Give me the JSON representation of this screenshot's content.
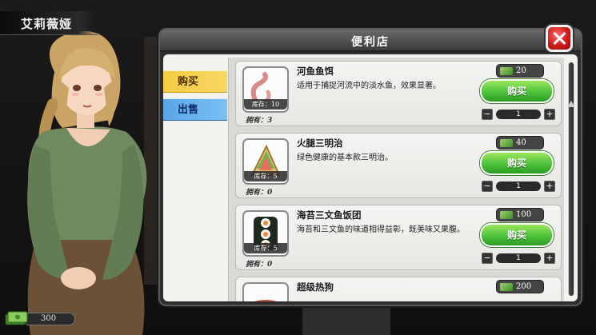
{
  "character": {
    "name": "艾莉薇娅"
  },
  "wallet": {
    "amount": "300"
  },
  "shop": {
    "title": "便利店",
    "tabs": [
      {
        "label": "购买",
        "active": true
      },
      {
        "label": "出售",
        "active": false
      }
    ],
    "items": [
      {
        "name": "河鱼鱼饵",
        "desc": "适用于捕捉河流中的淡水鱼，效果显著。",
        "price": "20",
        "stock": "库存：10",
        "owned": "拥有：3",
        "buy_label": "购买",
        "qty": "1",
        "icon": "worm-bait-icon"
      },
      {
        "name": "火腿三明治",
        "desc": "绿色健康的基本款三明治。",
        "price": "40",
        "stock": "库存：5",
        "owned": "拥有：0",
        "buy_label": "购买",
        "qty": "1",
        "icon": "sandwich-icon"
      },
      {
        "name": "海苔三文鱼饭团",
        "desc": "海苔和三文鱼的味道相得益彰，既美味又果腹。",
        "price": "100",
        "stock": "库存：5",
        "owned": "拥有：0",
        "buy_label": "购买",
        "qty": "1",
        "icon": "sushi-roll-icon"
      },
      {
        "name": "超级热狗",
        "desc": "",
        "price": "200",
        "stock": "",
        "owned": "",
        "buy_label": "",
        "qty": "",
        "icon": "hotdog-icon"
      }
    ]
  },
  "colors": {
    "buy_tab": "#f5cc43",
    "sell_tab": "#5aa5e8",
    "buy_button": "#4cc23a",
    "close_button": "#d01a1a"
  }
}
